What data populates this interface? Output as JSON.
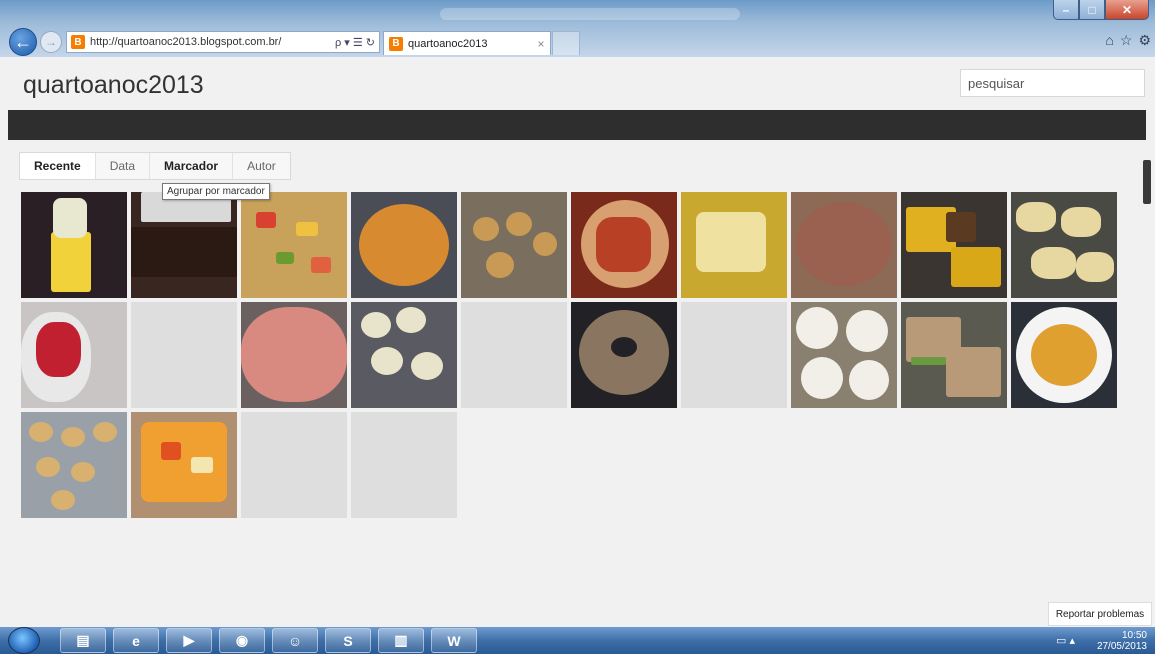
{
  "browser": {
    "url": "http://quartoanoc2013.blogspot.com.br/",
    "address_tools": "ρ ▾ ☰ ↻",
    "tab_title": "quartoanoc2013",
    "tab_close": "×",
    "back": "←",
    "forward": "→",
    "favicon": "B",
    "window_buttons": {
      "minimize": "–",
      "maximize": "□",
      "close": "✕"
    },
    "chrome_icons": {
      "home": "⌂",
      "favorites": "☆",
      "settings": "⚙"
    }
  },
  "blog": {
    "title": "quartoanoc2013",
    "search_placeholder": "pesquisar"
  },
  "view_tabs": [
    {
      "label": "Recente"
    },
    {
      "label": "Data"
    },
    {
      "label": "Marcador"
    },
    {
      "label": "Autor"
    }
  ],
  "tooltip": "Agrupar por marcador",
  "gallery": {
    "rows": [
      [
        {
          "icon": "juice-bottle-photo",
          "bg": "#2a1f25"
        },
        {
          "icon": "chocolate-cake-photo",
          "bg": "#3a2620"
        },
        {
          "icon": "fruit-salad-photo",
          "bg": "#c8a25a"
        },
        {
          "icon": "orange-pudding-photo",
          "bg": "#4a4d55"
        },
        {
          "icon": "pastries-tray-photo",
          "bg": "#7a6e5e"
        },
        {
          "icon": "fruit-cubes-photo",
          "bg": "#7a2a1a"
        },
        {
          "icon": "apple-cubes-photo",
          "bg": "#c9a830"
        },
        {
          "icon": "caramel-pie-photo",
          "bg": "#8d6a55"
        },
        {
          "icon": "corn-cake-photo",
          "bg": "#3a3530"
        },
        {
          "icon": "garlic-bread-photo",
          "bg": "#4a4a44"
        }
      ],
      [
        {
          "icon": "jelly-cups-photo",
          "bg": "#c9c5c5"
        },
        {
          "icon": "empty-tile",
          "bg": "#dedede"
        },
        {
          "icon": "pink-mousse-photo",
          "bg": "#6a6060"
        },
        {
          "icon": "dumplings-photo",
          "bg": "#5a5a62"
        },
        {
          "icon": "empty-tile",
          "bg": "#dedede"
        },
        {
          "icon": "bundt-cake-photo",
          "bg": "#222226"
        },
        {
          "icon": "empty-tile",
          "bg": "#dedede"
        },
        {
          "icon": "tartlets-photo",
          "bg": "#8a8070"
        },
        {
          "icon": "sandwiches-photo",
          "bg": "#5a5a50"
        },
        {
          "icon": "fruit-cocktail-photo",
          "bg": "#2a2f38"
        }
      ],
      [
        {
          "icon": "cookies-photo",
          "bg": "#9aa0a8"
        },
        {
          "icon": "fruit-bowl-photo",
          "bg": "#b09070"
        },
        {
          "icon": "empty-tile",
          "bg": "#dedede"
        },
        {
          "icon": "empty-tile",
          "bg": "#dedede"
        }
      ]
    ]
  },
  "report_button": "Reportar problemas",
  "taskbar": {
    "buttons": [
      {
        "icon": "explorer-icon",
        "glyph": "▤"
      },
      {
        "icon": "internet-explorer-icon",
        "glyph": "e"
      },
      {
        "icon": "media-player-icon",
        "glyph": "▶"
      },
      {
        "icon": "chrome-icon",
        "glyph": "◉"
      },
      {
        "icon": "users-icon",
        "glyph": "☺"
      },
      {
        "icon": "skype-icon",
        "glyph": "S"
      },
      {
        "icon": "document-icon",
        "glyph": "▥"
      },
      {
        "icon": "word-icon",
        "glyph": "W"
      }
    ],
    "time": "10:50",
    "date": "27/05/2013",
    "tray_icons": "▭ ▴"
  }
}
